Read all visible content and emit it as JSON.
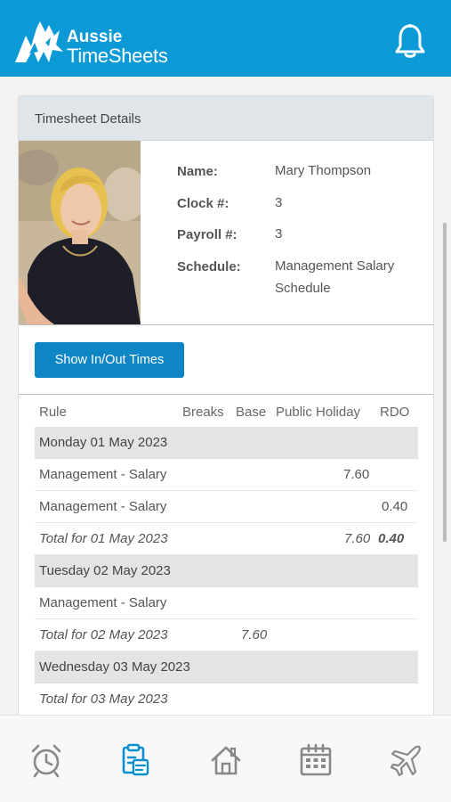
{
  "header": {
    "logo_line1": "Aussie",
    "logo_line2": "TimeSheets"
  },
  "card": {
    "title": "Timesheet Details"
  },
  "employee": {
    "name_label": "Name:",
    "name": "Mary Thompson",
    "clock_label": "Clock #:",
    "clock": "3",
    "payroll_label": "Payroll #:",
    "payroll": "3",
    "schedule_label": "Schedule:",
    "schedule": "Management Salary Schedule"
  },
  "buttons": {
    "show_in_out": "Show In/Out Times"
  },
  "table": {
    "columns": [
      "Rule",
      "Breaks",
      "Base",
      "Public Holiday",
      "RDO"
    ],
    "day1": {
      "title": "Monday 01 May 2023",
      "row1": {
        "rule": "Management - Salary",
        "public_holiday": "7.60"
      },
      "row2": {
        "rule": "Management - Salary",
        "rdo": "0.40"
      },
      "total": {
        "label": "Total for 01 May 2023",
        "public_holiday": "7.60",
        "rdo": "0.40"
      }
    },
    "day2": {
      "title": "Tuesday 02 May 2023",
      "row1": {
        "rule": "Management - Salary"
      },
      "total": {
        "label": "Total for 02 May 2023",
        "base": "7.60"
      }
    },
    "day3": {
      "title": "Wednesday 03 May 2023",
      "total": {
        "label": "Total for 03 May 2023"
      }
    }
  },
  "nav": {
    "items": [
      "alarm-clock-icon",
      "timesheet-icon",
      "home-icon",
      "calendar-icon",
      "airplane-icon"
    ],
    "active_color": "#0c8fd0",
    "inactive_color": "#888888"
  }
}
